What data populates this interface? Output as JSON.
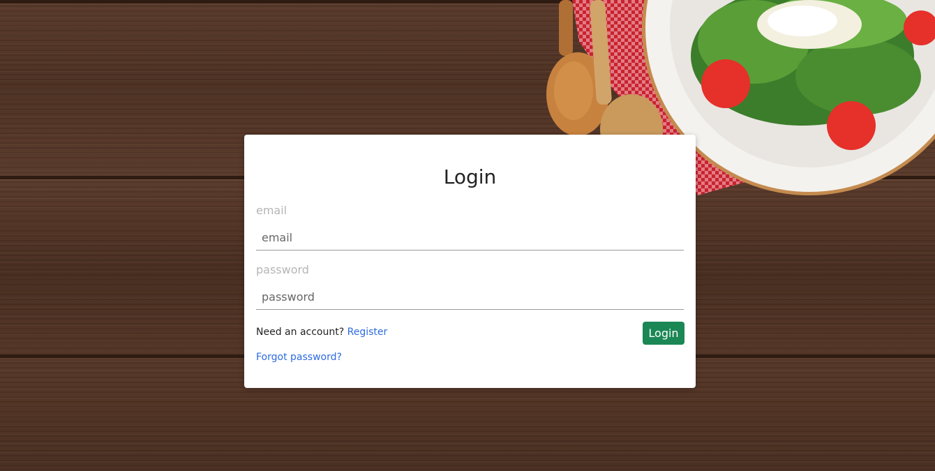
{
  "page": {
    "title": "Login"
  },
  "form": {
    "email_label": "email",
    "email_placeholder": "email",
    "password_label": "password",
    "password_placeholder": "password",
    "need_account_text": "Need an account?",
    "register_link": "Register",
    "login_button": "Login",
    "forgot_link": "Forgot password?"
  },
  "colors": {
    "accent": "#1b8755",
    "link": "#2d6be0",
    "background": "#4f3325"
  }
}
